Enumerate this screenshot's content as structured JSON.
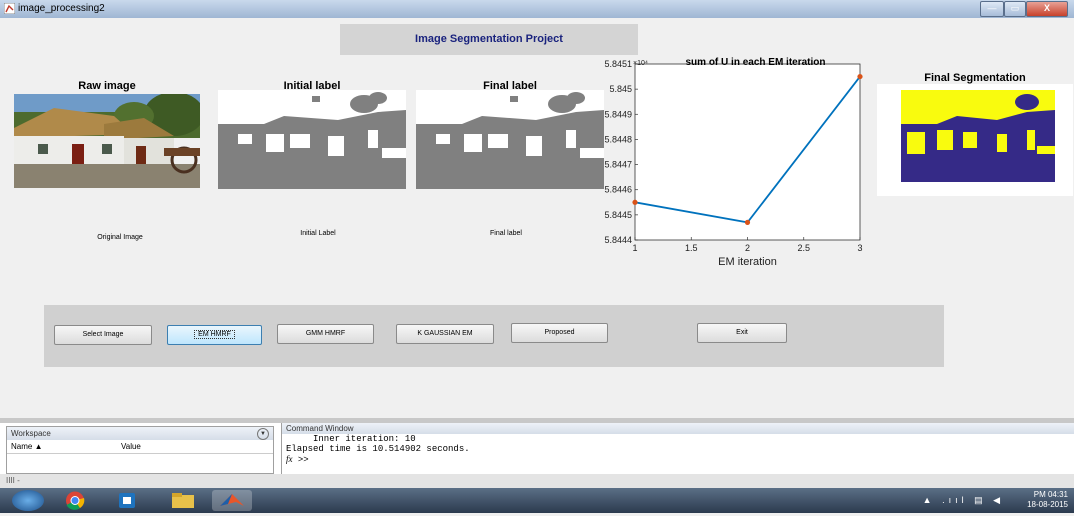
{
  "window": {
    "title": "image_processing2",
    "min_label": "—",
    "max_label": "▭",
    "close_label": "X"
  },
  "project_title": "Image Segmentation Project",
  "axes": {
    "raw": {
      "title": "Raw image",
      "caption": "Original Image"
    },
    "initial": {
      "title": "Initial label",
      "caption": "Initial Label"
    },
    "final": {
      "title": "Final label",
      "caption": "Final label"
    },
    "segmentation": {
      "title": "Final Segmentation"
    }
  },
  "chart_data": {
    "type": "line",
    "title": "sum of U in each EM iteration",
    "xlabel": "EM iteration",
    "ylabel": "",
    "y_exponent_label": "×10⁴",
    "x": [
      1,
      2,
      3
    ],
    "series": [
      {
        "values": [
          5.84455,
          5.84447,
          5.84505
        ]
      }
    ],
    "xlim": [
      1,
      3
    ],
    "ylim": [
      5.8444,
      5.8451
    ],
    "xticks": [
      "1",
      "1.5",
      "2",
      "2.5",
      "3"
    ],
    "yticks": [
      "5.8444",
      "5.8445",
      "5.8446",
      "5.8447",
      "5.8448",
      "5.8449",
      "5.845",
      "5.8451"
    ],
    "line_color": "#0072bd",
    "marker_color": "#d95319",
    "grid": false
  },
  "buttons": {
    "select_image": "Select Image",
    "em_hmrf": "EM HMRF",
    "gmm_hmrf": "GMM HMRF",
    "k_gaussian_em": "K GAUSSIAN EM",
    "proposed": "Proposed",
    "exit": "Exit"
  },
  "workspace": {
    "title": "Workspace",
    "col_name": "Name ▲",
    "col_value": "Value",
    "menu_icon": "▼"
  },
  "command_window": {
    "title": "Command Window",
    "lines": [
      "     Inner iteration: 10",
      "Elapsed time is 10.514902 seconds."
    ],
    "fx": "fx",
    "prompt": ">>"
  },
  "status_bar": {
    "text": "IIII -"
  },
  "taskbar": {
    "time": "PM 04:31",
    "date": "18-08-2015",
    "tray_icons": "▲ .ııl ▤ ◀"
  },
  "colors": {
    "title_blue": "#1a237e",
    "seg_dark": "#352a87",
    "seg_yellow": "#f9fb0e",
    "label_gray": "#808080"
  }
}
